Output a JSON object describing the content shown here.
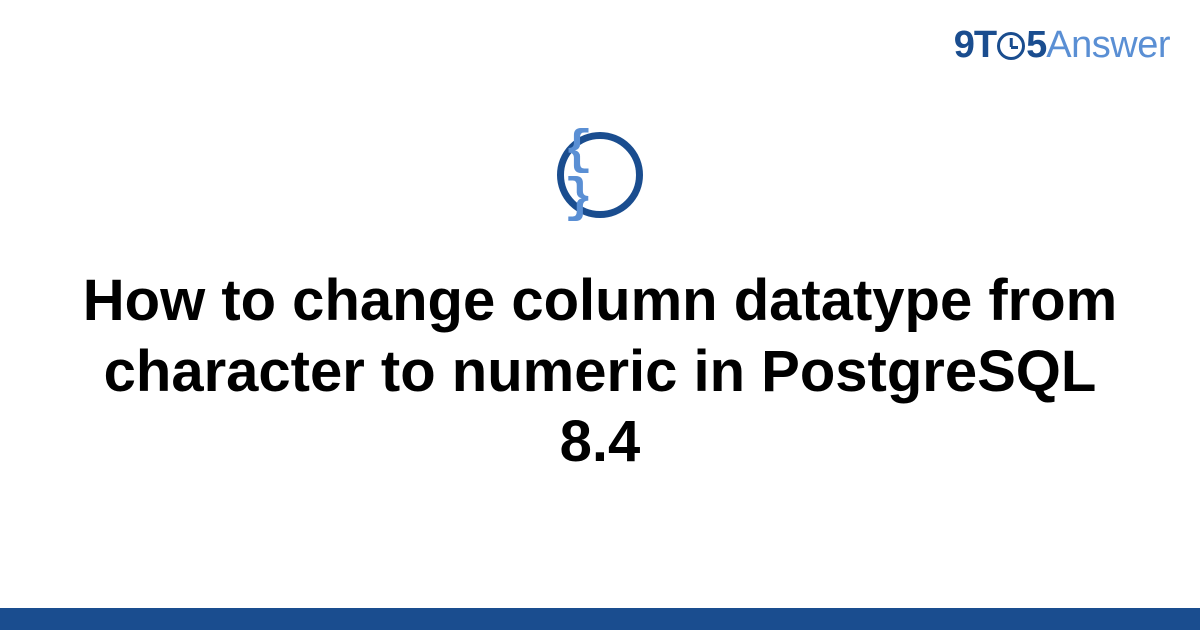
{
  "logo": {
    "part1": "9T",
    "part2": "5",
    "part3": "Answer"
  },
  "icon": {
    "name": "code-braces-icon",
    "glyph": "{ }"
  },
  "title": "How to change column datatype from character to numeric in PostgreSQL 8.4",
  "colors": {
    "brand_dark": "#1a4d8f",
    "brand_light": "#5a8fd4"
  }
}
